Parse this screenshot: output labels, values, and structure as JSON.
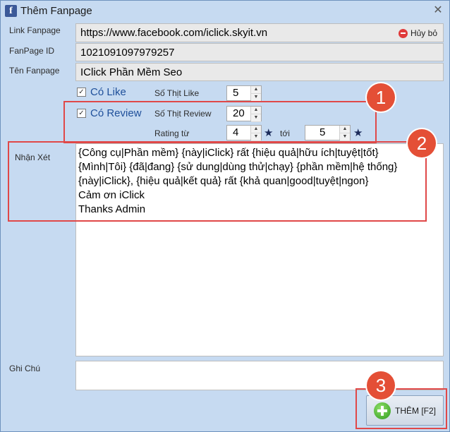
{
  "window": {
    "title": "Thêm Fanpage",
    "close_glyph": "✕"
  },
  "labels": {
    "link": "Link Fanpage",
    "fanpage_id": "FanPage ID",
    "name": "Tên Fanpage",
    "so_thit_like": "Số Thịt Like",
    "so_thit_review": "Số Thịt Review",
    "rating_tu": "Rating từ",
    "toi": "tới",
    "nhan_xet": "Nhận Xét",
    "ghi_chu": "Ghi Chú"
  },
  "fields": {
    "link": "https://www.facebook.com/iclick.skyit.vn",
    "fanpage_id": "1021091097979257",
    "name": "IClick Phần Mềm Seo"
  },
  "clear_button": "Hủy bỏ",
  "checks": {
    "like": {
      "label": "Có Like",
      "mark": "✓"
    },
    "review": {
      "label": "Có Review",
      "mark": "✓"
    }
  },
  "spinners": {
    "like": "5",
    "review": "20",
    "rating_from": "4",
    "rating_to": "5",
    "up": "▲",
    "down": "▼"
  },
  "star_glyph": "★",
  "comment_lines": [
    "{Công cụ|Phần mềm} {này|iClick} rất {hiệu quả|hữu ích|tuyệt|tốt}",
    "{Mình|Tôi} {đã|đang} {sử dung|dùng thử|chạy} {phần mềm|hệ thống}",
    "{này|iClick}, {hiệu quả|kết quả} rất {khả quan|good|tuyệt|ngon}",
    "Cảm ơn iClick",
    "Thanks Admin"
  ],
  "ghi_chu_value": "",
  "add_button": "THÊM [F2]",
  "badges": [
    "1",
    "2",
    "3"
  ],
  "colors": {
    "callout": "#e04848",
    "badge": "#e44f36",
    "window_bg": "#c6daf1"
  },
  "icons": [
    "facebook-icon",
    "close-icon",
    "no-entry-icon",
    "star-icon",
    "plus-circle-icon"
  ]
}
